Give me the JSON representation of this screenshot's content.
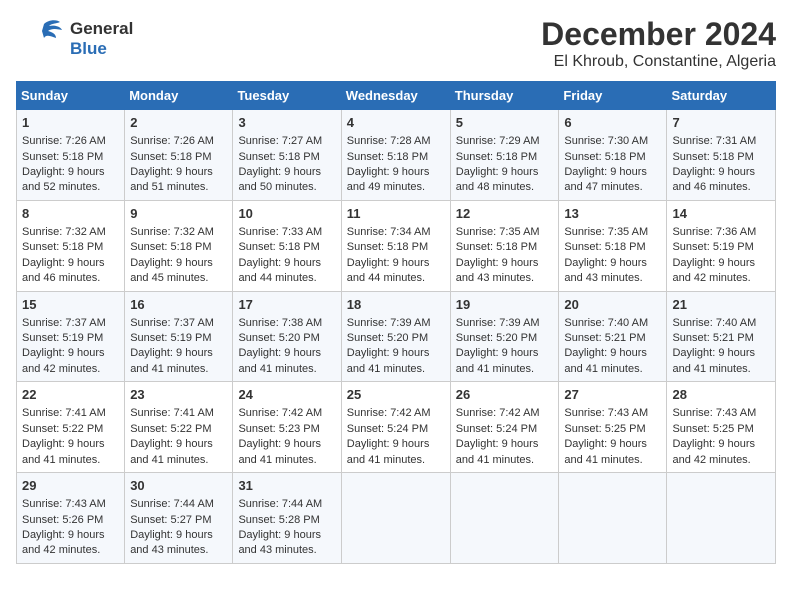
{
  "header": {
    "logo_line1": "General",
    "logo_line2": "Blue",
    "month": "December 2024",
    "location": "El Khroub, Constantine, Algeria"
  },
  "weekdays": [
    "Sunday",
    "Monday",
    "Tuesday",
    "Wednesday",
    "Thursday",
    "Friday",
    "Saturday"
  ],
  "weeks": [
    [
      {
        "day": "1",
        "sunrise": "7:26 AM",
        "sunset": "5:18 PM",
        "daylight": "9 hours and 52 minutes."
      },
      {
        "day": "2",
        "sunrise": "7:26 AM",
        "sunset": "5:18 PM",
        "daylight": "9 hours and 51 minutes."
      },
      {
        "day": "3",
        "sunrise": "7:27 AM",
        "sunset": "5:18 PM",
        "daylight": "9 hours and 50 minutes."
      },
      {
        "day": "4",
        "sunrise": "7:28 AM",
        "sunset": "5:18 PM",
        "daylight": "9 hours and 49 minutes."
      },
      {
        "day": "5",
        "sunrise": "7:29 AM",
        "sunset": "5:18 PM",
        "daylight": "9 hours and 48 minutes."
      },
      {
        "day": "6",
        "sunrise": "7:30 AM",
        "sunset": "5:18 PM",
        "daylight": "9 hours and 47 minutes."
      },
      {
        "day": "7",
        "sunrise": "7:31 AM",
        "sunset": "5:18 PM",
        "daylight": "9 hours and 46 minutes."
      }
    ],
    [
      {
        "day": "8",
        "sunrise": "7:32 AM",
        "sunset": "5:18 PM",
        "daylight": "9 hours and 46 minutes."
      },
      {
        "day": "9",
        "sunrise": "7:32 AM",
        "sunset": "5:18 PM",
        "daylight": "9 hours and 45 minutes."
      },
      {
        "day": "10",
        "sunrise": "7:33 AM",
        "sunset": "5:18 PM",
        "daylight": "9 hours and 44 minutes."
      },
      {
        "day": "11",
        "sunrise": "7:34 AM",
        "sunset": "5:18 PM",
        "daylight": "9 hours and 44 minutes."
      },
      {
        "day": "12",
        "sunrise": "7:35 AM",
        "sunset": "5:18 PM",
        "daylight": "9 hours and 43 minutes."
      },
      {
        "day": "13",
        "sunrise": "7:35 AM",
        "sunset": "5:18 PM",
        "daylight": "9 hours and 43 minutes."
      },
      {
        "day": "14",
        "sunrise": "7:36 AM",
        "sunset": "5:19 PM",
        "daylight": "9 hours and 42 minutes."
      }
    ],
    [
      {
        "day": "15",
        "sunrise": "7:37 AM",
        "sunset": "5:19 PM",
        "daylight": "9 hours and 42 minutes."
      },
      {
        "day": "16",
        "sunrise": "7:37 AM",
        "sunset": "5:19 PM",
        "daylight": "9 hours and 41 minutes."
      },
      {
        "day": "17",
        "sunrise": "7:38 AM",
        "sunset": "5:20 PM",
        "daylight": "9 hours and 41 minutes."
      },
      {
        "day": "18",
        "sunrise": "7:39 AM",
        "sunset": "5:20 PM",
        "daylight": "9 hours and 41 minutes."
      },
      {
        "day": "19",
        "sunrise": "7:39 AM",
        "sunset": "5:20 PM",
        "daylight": "9 hours and 41 minutes."
      },
      {
        "day": "20",
        "sunrise": "7:40 AM",
        "sunset": "5:21 PM",
        "daylight": "9 hours and 41 minutes."
      },
      {
        "day": "21",
        "sunrise": "7:40 AM",
        "sunset": "5:21 PM",
        "daylight": "9 hours and 41 minutes."
      }
    ],
    [
      {
        "day": "22",
        "sunrise": "7:41 AM",
        "sunset": "5:22 PM",
        "daylight": "9 hours and 41 minutes."
      },
      {
        "day": "23",
        "sunrise": "7:41 AM",
        "sunset": "5:22 PM",
        "daylight": "9 hours and 41 minutes."
      },
      {
        "day": "24",
        "sunrise": "7:42 AM",
        "sunset": "5:23 PM",
        "daylight": "9 hours and 41 minutes."
      },
      {
        "day": "25",
        "sunrise": "7:42 AM",
        "sunset": "5:24 PM",
        "daylight": "9 hours and 41 minutes."
      },
      {
        "day": "26",
        "sunrise": "7:42 AM",
        "sunset": "5:24 PM",
        "daylight": "9 hours and 41 minutes."
      },
      {
        "day": "27",
        "sunrise": "7:43 AM",
        "sunset": "5:25 PM",
        "daylight": "9 hours and 41 minutes."
      },
      {
        "day": "28",
        "sunrise": "7:43 AM",
        "sunset": "5:25 PM",
        "daylight": "9 hours and 42 minutes."
      }
    ],
    [
      {
        "day": "29",
        "sunrise": "7:43 AM",
        "sunset": "5:26 PM",
        "daylight": "9 hours and 42 minutes."
      },
      {
        "day": "30",
        "sunrise": "7:44 AM",
        "sunset": "5:27 PM",
        "daylight": "9 hours and 43 minutes."
      },
      {
        "day": "31",
        "sunrise": "7:44 AM",
        "sunset": "5:28 PM",
        "daylight": "9 hours and 43 minutes."
      },
      null,
      null,
      null,
      null
    ]
  ],
  "colors": {
    "header_bg": "#2a6db5",
    "odd_row": "#f5f8fc",
    "even_row": "#ffffff"
  }
}
